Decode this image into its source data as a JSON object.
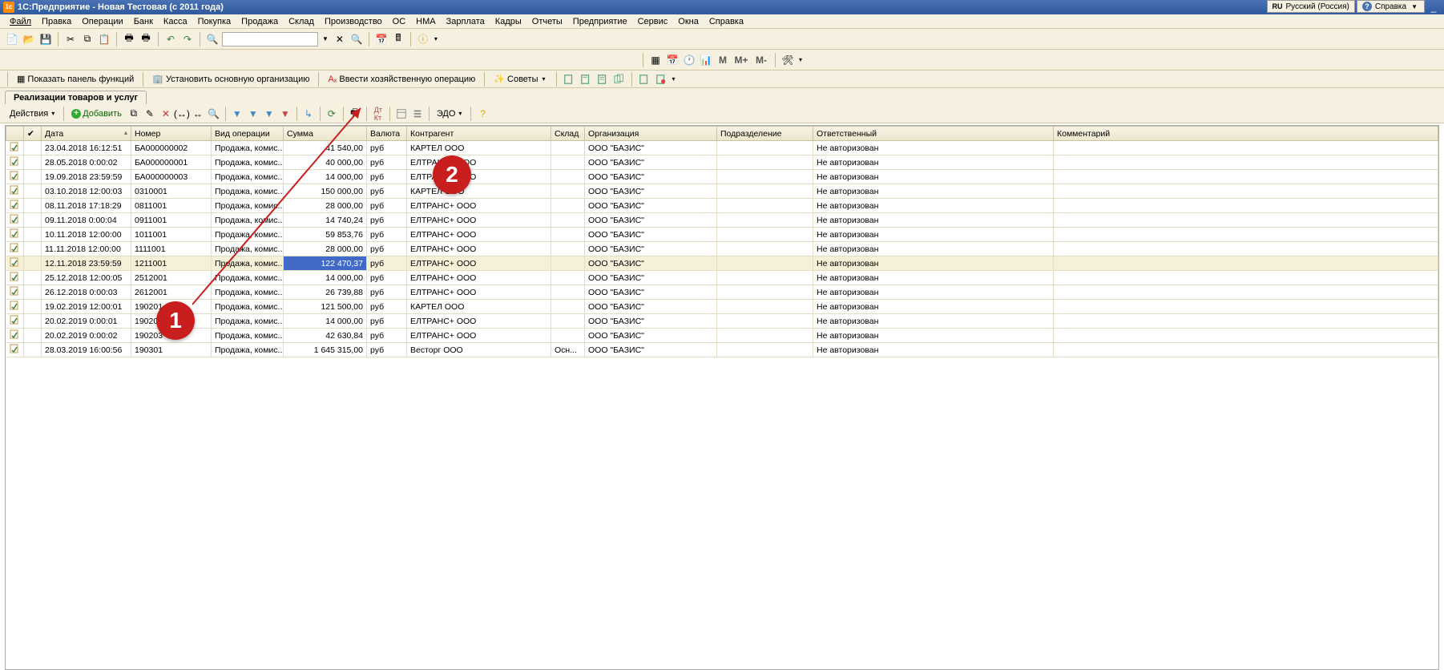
{
  "title": "1С:Предприятие - Новая Тестовая (с 2011 года)",
  "lang": {
    "code": "RU",
    "label": "Русский (Россия)"
  },
  "help": {
    "label": "Справка"
  },
  "menu": [
    "Файл",
    "Правка",
    "Операции",
    "Банк",
    "Касса",
    "Покупка",
    "Продажа",
    "Склад",
    "Производство",
    "ОС",
    "НМА",
    "Зарплата",
    "Кадры",
    "Отчеты",
    "Предприятие",
    "Сервис",
    "Окна",
    "Справка"
  ],
  "toolbar2": {
    "m": "M",
    "mplus": "M+",
    "mminus": "M-"
  },
  "toolbar3": {
    "showPanel": "Показать панель функций",
    "setOrg": "Установить основную организацию",
    "enterOp": "Ввести хозяйственную операцию",
    "tips": "Советы"
  },
  "tab": "Реализации товаров и услуг",
  "listToolbar": {
    "actions": "Действия",
    "add": "Добавить",
    "edo": "ЭДО"
  },
  "columns": [
    "",
    "",
    "Дата",
    "Номер",
    "Вид операции",
    "Сумма",
    "Валюта",
    "Контрагент",
    "Склад",
    "Организация",
    "Подразделение",
    "Ответственный",
    "Комментарий"
  ],
  "selectedRowIndex": 7,
  "rows": [
    {
      "date": "23.04.2018 16:12:51",
      "num": "БА000000002",
      "op": "Продажа, комис...",
      "sum": "41 540,00",
      "cur": "руб",
      "contr": "КАРТЕЛ ООО",
      "wh": "",
      "org": "ООО \"БАЗИС\"",
      "dep": "",
      "resp": "Не авторизован",
      "comm": ""
    },
    {
      "date": "28.05.2018 0:00:02",
      "num": "БА000000001",
      "op": "Продажа, комис...",
      "sum": "40 000,00",
      "cur": "руб",
      "contr": "ЕЛТРАНС+ ООО",
      "wh": "",
      "org": "ООО \"БАЗИС\"",
      "dep": "",
      "resp": "Не авторизован",
      "comm": ""
    },
    {
      "date": "19.09.2018 23:59:59",
      "num": "БА000000003",
      "op": "Продажа, комис...",
      "sum": "14 000,00",
      "cur": "руб",
      "contr": "ЕЛТРАНС+ ООО",
      "wh": "",
      "org": "ООО \"БАЗИС\"",
      "dep": "",
      "resp": "Не авторизован",
      "comm": ""
    },
    {
      "date": "03.10.2018 12:00:03",
      "num": "0310001",
      "op": "Продажа, комис...",
      "sum": "150 000,00",
      "cur": "руб",
      "contr": "КАРТЕЛ ООО",
      "wh": "",
      "org": "ООО \"БАЗИС\"",
      "dep": "",
      "resp": "Не авторизован",
      "comm": ""
    },
    {
      "date": "08.11.2018 17:18:29",
      "num": "0811001",
      "op": "Продажа, комис...",
      "sum": "28 000,00",
      "cur": "руб",
      "contr": "ЕЛТРАНС+ ООО",
      "wh": "",
      "org": "ООО \"БАЗИС\"",
      "dep": "",
      "resp": "Не авторизован",
      "comm": ""
    },
    {
      "date": "09.11.2018 0:00:04",
      "num": "0911001",
      "op": "Продажа, комис...",
      "sum": "14 740,24",
      "cur": "руб",
      "contr": "ЕЛТРАНС+ ООО",
      "wh": "",
      "org": "ООО \"БАЗИС\"",
      "dep": "",
      "resp": "Не авторизован",
      "comm": ""
    },
    {
      "date": "10.11.2018 12:00:00",
      "num": "1011001",
      "op": "Продажа, комис...",
      "sum": "59 853,76",
      "cur": "руб",
      "contr": "ЕЛТРАНС+ ООО",
      "wh": "",
      "org": "ООО \"БАЗИС\"",
      "dep": "",
      "resp": "Не авторизован",
      "comm": ""
    },
    {
      "date": "11.11.2018 12:00:00",
      "num": "1111001",
      "op": "Продажа, комис...",
      "sum": "28 000,00",
      "cur": "руб",
      "contr": "ЕЛТРАНС+ ООО",
      "wh": "",
      "org": "ООО \"БАЗИС\"",
      "dep": "",
      "resp": "Не авторизован",
      "comm": ""
    },
    {
      "date": "12.11.2018 23:59:59",
      "num": "1211001",
      "op": "Продажа, комис...",
      "sum": "122 470,37",
      "cur": "руб",
      "contr": "ЕЛТРАНС+ ООО",
      "wh": "",
      "org": "ООО \"БАЗИС\"",
      "dep": "",
      "resp": "Не авторизован",
      "comm": ""
    },
    {
      "date": "25.12.2018 12:00:05",
      "num": "2512001",
      "op": "Продажа, комис...",
      "sum": "14 000,00",
      "cur": "руб",
      "contr": "ЕЛТРАНС+ ООО",
      "wh": "",
      "org": "ООО \"БАЗИС\"",
      "dep": "",
      "resp": "Не авторизован",
      "comm": ""
    },
    {
      "date": "26.12.2018 0:00:03",
      "num": "2612001",
      "op": "Продажа, комис...",
      "sum": "26 739,88",
      "cur": "руб",
      "contr": "ЕЛТРАНС+ ООО",
      "wh": "",
      "org": "ООО \"БАЗИС\"",
      "dep": "",
      "resp": "Не авторизован",
      "comm": ""
    },
    {
      "date": "19.02.2019 12:00:01",
      "num": "190201",
      "op": "Продажа, комис...",
      "sum": "121 500,00",
      "cur": "руб",
      "contr": "КАРТЕЛ ООО",
      "wh": "",
      "org": "ООО \"БАЗИС\"",
      "dep": "",
      "resp": "Не авторизован",
      "comm": ""
    },
    {
      "date": "20.02.2019 0:00:01",
      "num": "190202",
      "op": "Продажа, комис...",
      "sum": "14 000,00",
      "cur": "руб",
      "contr": "ЕЛТРАНС+ ООО",
      "wh": "",
      "org": "ООО \"БАЗИС\"",
      "dep": "",
      "resp": "Не авторизован",
      "comm": ""
    },
    {
      "date": "20.02.2019 0:00:02",
      "num": "190203",
      "op": "Продажа, комис...",
      "sum": "42 630,84",
      "cur": "руб",
      "contr": "ЕЛТРАНС+ ООО",
      "wh": "",
      "org": "ООО \"БАЗИС\"",
      "dep": "",
      "resp": "Не авторизован",
      "comm": ""
    },
    {
      "date": "28.03.2019 16:00:56",
      "num": "190301",
      "op": "Продажа, комис...",
      "sum": "1 645 315,00",
      "cur": "руб",
      "contr": "Весторг ООО",
      "wh": "Осн...",
      "org": "ООО \"БАЗИС\"",
      "dep": "",
      "resp": "Не авторизован",
      "comm": ""
    }
  ],
  "callouts": {
    "c1": "1",
    "c2": "2"
  }
}
